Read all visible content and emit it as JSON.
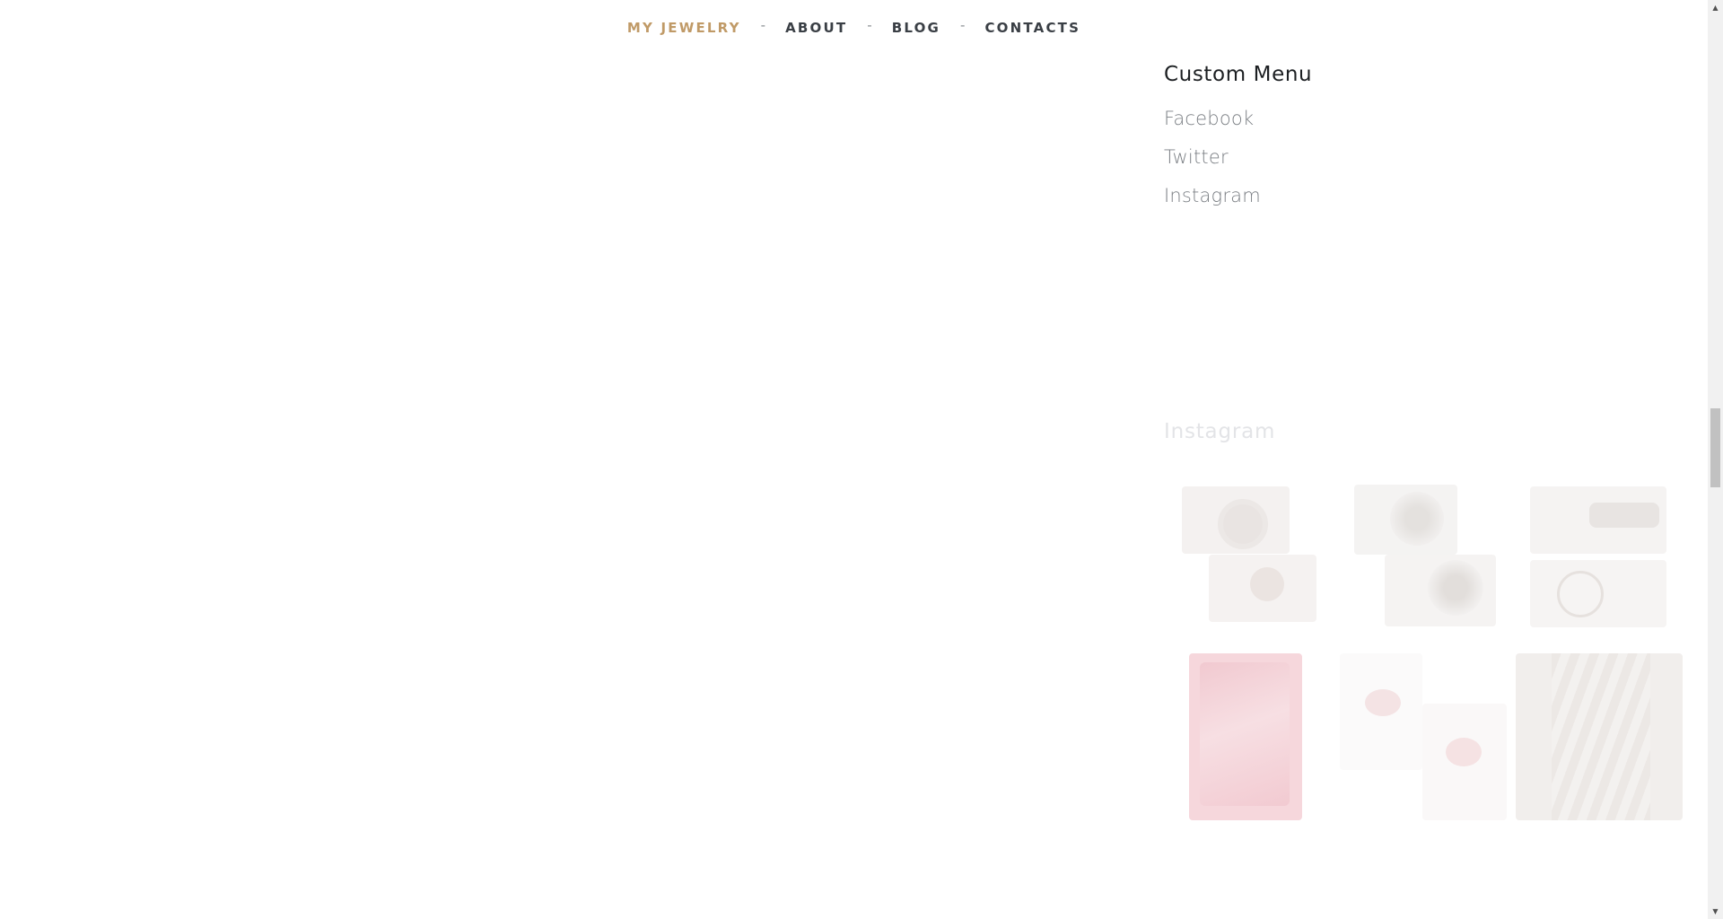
{
  "nav": {
    "items": [
      {
        "label": "MY JEWELRY",
        "active": true
      },
      {
        "label": "ABOUT",
        "active": false
      },
      {
        "label": "BLOG",
        "active": false
      },
      {
        "label": "CONTACTS",
        "active": false
      }
    ],
    "separator": "-",
    "active_color": "#c09a67",
    "text_color": "#3a3f45"
  },
  "sidebar": {
    "custom_menu": {
      "title": "Custom Menu",
      "links": [
        "Facebook",
        "Twitter",
        "Instagram"
      ]
    },
    "instagram": {
      "title": "Instagram",
      "tiles": [
        {
          "icon": "rings-photo-icon"
        },
        {
          "icon": "flower-ring-photo-icon"
        },
        {
          "icon": "bracelet-ring-photo-icon"
        },
        {
          "icon": "red-mittens-photo-icon"
        },
        {
          "icon": "coral-rings-photo-icon"
        },
        {
          "icon": "beaded-bracelet-photo-icon"
        }
      ]
    }
  },
  "scrollbar": {
    "up_glyph": "▲",
    "down_glyph": "▼"
  }
}
